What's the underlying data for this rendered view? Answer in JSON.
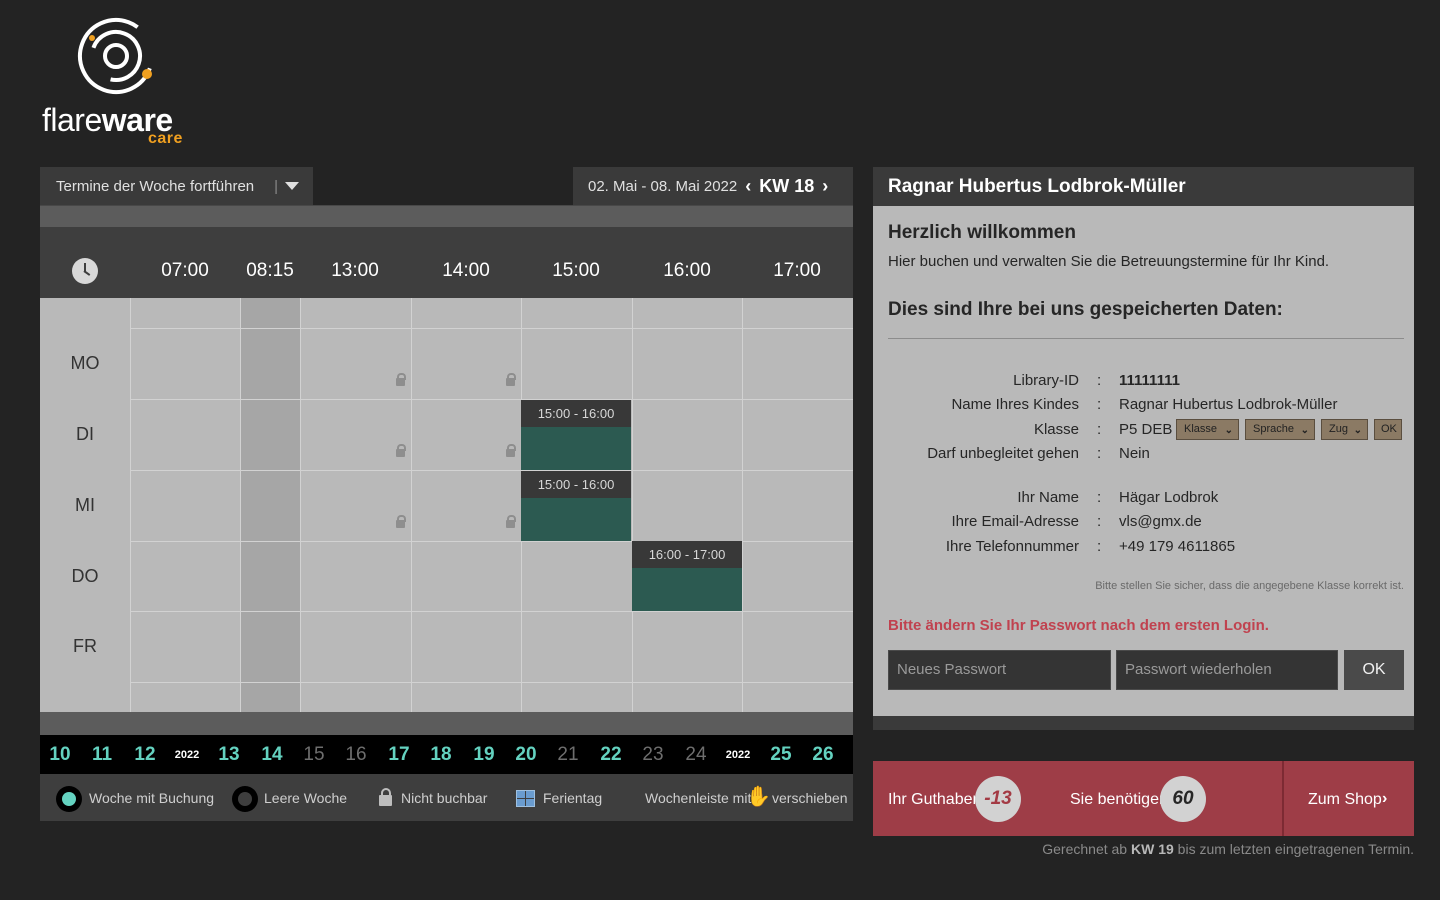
{
  "brand": {
    "word_light": "flare",
    "word_bold": "ware",
    "sub": "care",
    "accent": "#f0a020"
  },
  "calendar": {
    "select_label": "Termine der Woche fortführen",
    "select_sep": "|",
    "date_range": "02. Mai - 08. Mai 2022",
    "kw_label": "KW 18",
    "prev_icon": "chevron-left-icon",
    "next_icon": "chevron-right-icon",
    "times": [
      "07:00",
      "08:15",
      "13:00",
      "14:00",
      "15:00",
      "16:00",
      "17:00"
    ],
    "days": [
      "MO",
      "DI",
      "MI",
      "DO",
      "FR"
    ],
    "bookings": [
      {
        "day": "DI",
        "label": "15:00 - 16:00"
      },
      {
        "day": "MI",
        "label": "15:00 - 16:00"
      },
      {
        "day": "DO",
        "label": "16:00 - 17:00"
      }
    ],
    "booking_color": "#2c5a51",
    "weeks": [
      {
        "n": "10",
        "s": "on"
      },
      {
        "n": "11",
        "s": "on"
      },
      {
        "n": "12",
        "s": "on"
      },
      {
        "n": "2022",
        "s": "yr"
      },
      {
        "n": "13",
        "s": "on"
      },
      {
        "n": "14",
        "s": "on"
      },
      {
        "n": "15",
        "s": "off"
      },
      {
        "n": "16",
        "s": "off"
      },
      {
        "n": "17",
        "s": "on"
      },
      {
        "n": "18",
        "s": "on"
      },
      {
        "n": "19",
        "s": "on"
      },
      {
        "n": "20",
        "s": "on"
      },
      {
        "n": "21",
        "s": "off"
      },
      {
        "n": "22",
        "s": "on"
      },
      {
        "n": "23",
        "s": "off"
      },
      {
        "n": "24",
        "s": "off"
      },
      {
        "n": "2022",
        "s": "yr"
      },
      {
        "n": "25",
        "s": "on"
      },
      {
        "n": "26",
        "s": "on"
      }
    ],
    "legend": {
      "booked": "Woche mit Buchung",
      "empty": "Leere Woche",
      "locked": "Nicht buchbar",
      "holiday": "Ferientag",
      "drag_pre": "Wochenleiste mit",
      "drag_post": "verschieben"
    }
  },
  "profile": {
    "header_name": "Ragnar Hubertus Lodbrok-Müller",
    "welcome_title": "Herzlich willkommen",
    "welcome_text": "Hier buchen und verwalten Sie die Betreuungstermine für Ihr Kind.",
    "data_title": "Dies sind Ihre bei uns gespeicherten Daten:",
    "fields": [
      {
        "label": "Library-ID",
        "value": "11111111"
      },
      {
        "label": "Name Ihres Kindes",
        "value": "Ragnar Hubertus Lodbrok-Müller"
      },
      {
        "label": "Klasse",
        "value": "P5 DEB"
      },
      {
        "label": "Darf unbegleitet gehen",
        "value": "Nein"
      },
      {
        "label": "Ihr Name",
        "value": "Hägar Lodbrok"
      },
      {
        "label": "Ihre Email-Adresse",
        "value": "vls@gmx.de"
      },
      {
        "label": "Ihre Telefonnummer",
        "value": "+49 179 4611865"
      }
    ],
    "colon": ":",
    "class_selects": {
      "klasse": "Klasse",
      "sprache": "Sprache",
      "zug": "Zug",
      "ok": "OK"
    },
    "class_note": "Bitte stellen Sie sicher, dass die angegebene Klasse korrekt ist.",
    "pw_warning": "Bitte ändern Sie Ihr Passwort nach dem ersten Login.",
    "pw_new_placeholder": "Neues Passwort",
    "pw_repeat_placeholder": "Passwort wiederholen",
    "pw_ok": "OK"
  },
  "credit": {
    "balance_label": "Ihr Guthaben",
    "balance_value": "-13",
    "need_label": "Sie benötigen",
    "need_value": "60",
    "shop_label": "Zum Shop",
    "note_pre": "Gerechnet ab",
    "note_kw": "KW 19",
    "note_post": "bis zum letzten eingetragenen Termin.",
    "bar_color": "#9e3d47"
  }
}
